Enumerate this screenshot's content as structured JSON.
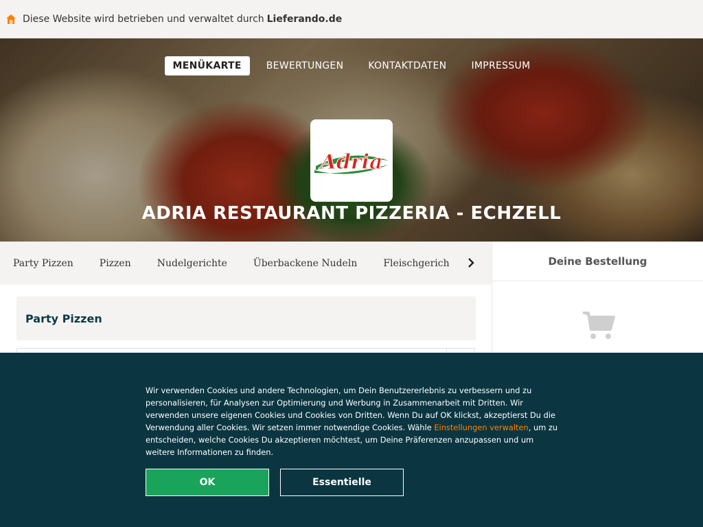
{
  "topbar": {
    "notice": "Diese Website wird betrieben und verwaltet durch",
    "brand": "Lieferando.de",
    "icon": "home-icon",
    "accent": "#ff8000"
  },
  "nav": {
    "items": [
      {
        "label": "MENÜKARTE",
        "active": true
      },
      {
        "label": "BEWERTUNGEN",
        "active": false
      },
      {
        "label": "KONTAKTDATEN",
        "active": false
      },
      {
        "label": "IMPRESSUM",
        "active": false
      }
    ]
  },
  "restaurant": {
    "logo_text": "Adria",
    "name": "ADRIA RESTAURANT PIZZERIA - ECHZELL"
  },
  "categories": {
    "items": [
      "Party Pizzen",
      "Pizzen",
      "Nudelgerichte",
      "Überbackene Nudeln",
      "Fleischgerichte vom"
    ],
    "next_icon": "chevron-right-icon"
  },
  "section": {
    "title": "Party Pizzen"
  },
  "basket": {
    "title": "Deine Bestellung",
    "icon": "cart-icon"
  },
  "cookie": {
    "text_before": "Wir verwenden Cookies und andere Technologien, um Dein Benutzererlebnis zu verbessern und zu personalisieren, für Analysen zur Optimierung und Werbung in Zusammenarbeit mit Dritten. Wir verwenden unsere eigenen Cookies und Cookies von Dritten. Wenn Du auf OK klickst, akzeptierst Du die Verwendung aller Cookies. Wir setzen immer notwendige Cookies. Wähle ",
    "link": "Einstellungen verwalten",
    "text_after": ", um zu entscheiden, welche Cookies Du akzeptieren möchtest, um Deine Präferenzen anzupassen und um weitere Informationen zu finden.",
    "ok_label": "OK",
    "essential_label": "Essentielle",
    "bg_color": "#0b3641",
    "ok_color": "#1aa35a"
  }
}
